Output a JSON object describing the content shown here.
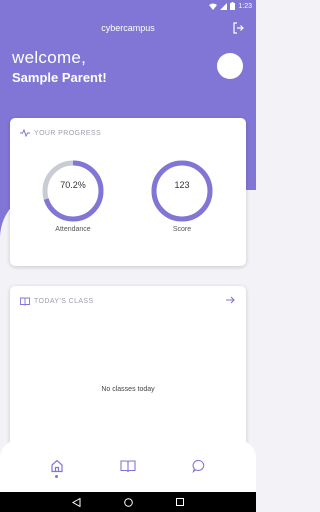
{
  "status": {
    "time": "1:23"
  },
  "app": {
    "title": "cybercampus"
  },
  "welcome": {
    "greeting": "welcome,",
    "name": "Sample Parent!"
  },
  "progress": {
    "header": "YOUR PROGRESS",
    "attendance": {
      "value": "70.2%",
      "label": "Attendance",
      "fraction": 0.702
    },
    "score": {
      "value": "123",
      "label": "Score",
      "fraction": 1.0
    }
  },
  "today_class": {
    "header": "TODAY'S CLASS",
    "empty_text": "No classes today"
  },
  "colors": {
    "accent": "#8176d6",
    "ring_track": "#c9ccd2",
    "background": "#f3f3f7"
  },
  "bottom_nav": {
    "items": [
      {
        "icon": "home-icon",
        "active": true
      },
      {
        "icon": "book-icon",
        "active": false
      },
      {
        "icon": "chat-icon",
        "active": false
      }
    ]
  }
}
